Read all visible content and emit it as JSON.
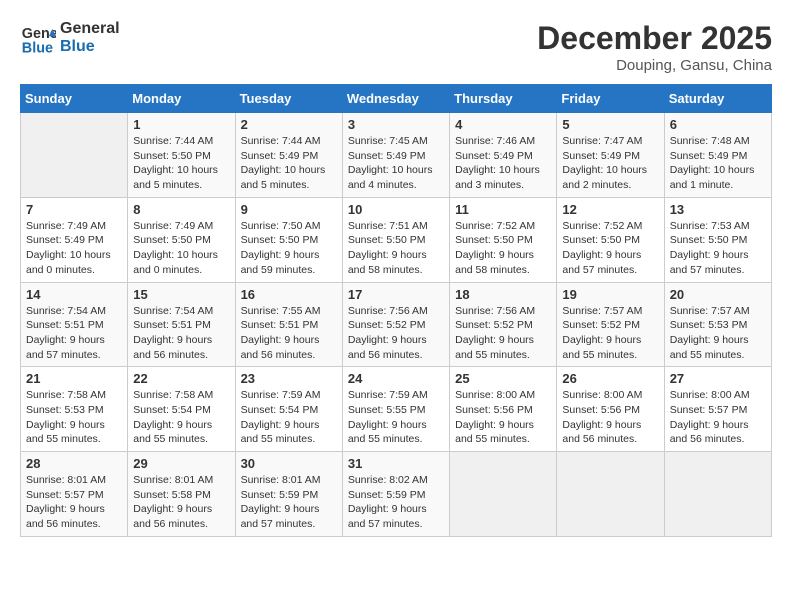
{
  "header": {
    "logo_line1": "General",
    "logo_line2": "Blue",
    "month": "December 2025",
    "location": "Douping, Gansu, China"
  },
  "weekdays": [
    "Sunday",
    "Monday",
    "Tuesday",
    "Wednesday",
    "Thursday",
    "Friday",
    "Saturday"
  ],
  "weeks": [
    [
      {
        "day": "",
        "info": ""
      },
      {
        "day": "1",
        "info": "Sunrise: 7:44 AM\nSunset: 5:50 PM\nDaylight: 10 hours\nand 5 minutes."
      },
      {
        "day": "2",
        "info": "Sunrise: 7:44 AM\nSunset: 5:49 PM\nDaylight: 10 hours\nand 5 minutes."
      },
      {
        "day": "3",
        "info": "Sunrise: 7:45 AM\nSunset: 5:49 PM\nDaylight: 10 hours\nand 4 minutes."
      },
      {
        "day": "4",
        "info": "Sunrise: 7:46 AM\nSunset: 5:49 PM\nDaylight: 10 hours\nand 3 minutes."
      },
      {
        "day": "5",
        "info": "Sunrise: 7:47 AM\nSunset: 5:49 PM\nDaylight: 10 hours\nand 2 minutes."
      },
      {
        "day": "6",
        "info": "Sunrise: 7:48 AM\nSunset: 5:49 PM\nDaylight: 10 hours\nand 1 minute."
      }
    ],
    [
      {
        "day": "7",
        "info": "Sunrise: 7:49 AM\nSunset: 5:49 PM\nDaylight: 10 hours\nand 0 minutes."
      },
      {
        "day": "8",
        "info": "Sunrise: 7:49 AM\nSunset: 5:50 PM\nDaylight: 10 hours\nand 0 minutes."
      },
      {
        "day": "9",
        "info": "Sunrise: 7:50 AM\nSunset: 5:50 PM\nDaylight: 9 hours\nand 59 minutes."
      },
      {
        "day": "10",
        "info": "Sunrise: 7:51 AM\nSunset: 5:50 PM\nDaylight: 9 hours\nand 58 minutes."
      },
      {
        "day": "11",
        "info": "Sunrise: 7:52 AM\nSunset: 5:50 PM\nDaylight: 9 hours\nand 58 minutes."
      },
      {
        "day": "12",
        "info": "Sunrise: 7:52 AM\nSunset: 5:50 PM\nDaylight: 9 hours\nand 57 minutes."
      },
      {
        "day": "13",
        "info": "Sunrise: 7:53 AM\nSunset: 5:50 PM\nDaylight: 9 hours\nand 57 minutes."
      }
    ],
    [
      {
        "day": "14",
        "info": "Sunrise: 7:54 AM\nSunset: 5:51 PM\nDaylight: 9 hours\nand 57 minutes."
      },
      {
        "day": "15",
        "info": "Sunrise: 7:54 AM\nSunset: 5:51 PM\nDaylight: 9 hours\nand 56 minutes."
      },
      {
        "day": "16",
        "info": "Sunrise: 7:55 AM\nSunset: 5:51 PM\nDaylight: 9 hours\nand 56 minutes."
      },
      {
        "day": "17",
        "info": "Sunrise: 7:56 AM\nSunset: 5:52 PM\nDaylight: 9 hours\nand 56 minutes."
      },
      {
        "day": "18",
        "info": "Sunrise: 7:56 AM\nSunset: 5:52 PM\nDaylight: 9 hours\nand 55 minutes."
      },
      {
        "day": "19",
        "info": "Sunrise: 7:57 AM\nSunset: 5:52 PM\nDaylight: 9 hours\nand 55 minutes."
      },
      {
        "day": "20",
        "info": "Sunrise: 7:57 AM\nSunset: 5:53 PM\nDaylight: 9 hours\nand 55 minutes."
      }
    ],
    [
      {
        "day": "21",
        "info": "Sunrise: 7:58 AM\nSunset: 5:53 PM\nDaylight: 9 hours\nand 55 minutes."
      },
      {
        "day": "22",
        "info": "Sunrise: 7:58 AM\nSunset: 5:54 PM\nDaylight: 9 hours\nand 55 minutes."
      },
      {
        "day": "23",
        "info": "Sunrise: 7:59 AM\nSunset: 5:54 PM\nDaylight: 9 hours\nand 55 minutes."
      },
      {
        "day": "24",
        "info": "Sunrise: 7:59 AM\nSunset: 5:55 PM\nDaylight: 9 hours\nand 55 minutes."
      },
      {
        "day": "25",
        "info": "Sunrise: 8:00 AM\nSunset: 5:56 PM\nDaylight: 9 hours\nand 55 minutes."
      },
      {
        "day": "26",
        "info": "Sunrise: 8:00 AM\nSunset: 5:56 PM\nDaylight: 9 hours\nand 56 minutes."
      },
      {
        "day": "27",
        "info": "Sunrise: 8:00 AM\nSunset: 5:57 PM\nDaylight: 9 hours\nand 56 minutes."
      }
    ],
    [
      {
        "day": "28",
        "info": "Sunrise: 8:01 AM\nSunset: 5:57 PM\nDaylight: 9 hours\nand 56 minutes."
      },
      {
        "day": "29",
        "info": "Sunrise: 8:01 AM\nSunset: 5:58 PM\nDaylight: 9 hours\nand 56 minutes."
      },
      {
        "day": "30",
        "info": "Sunrise: 8:01 AM\nSunset: 5:59 PM\nDaylight: 9 hours\nand 57 minutes."
      },
      {
        "day": "31",
        "info": "Sunrise: 8:02 AM\nSunset: 5:59 PM\nDaylight: 9 hours\nand 57 minutes."
      },
      {
        "day": "",
        "info": ""
      },
      {
        "day": "",
        "info": ""
      },
      {
        "day": "",
        "info": ""
      }
    ]
  ]
}
